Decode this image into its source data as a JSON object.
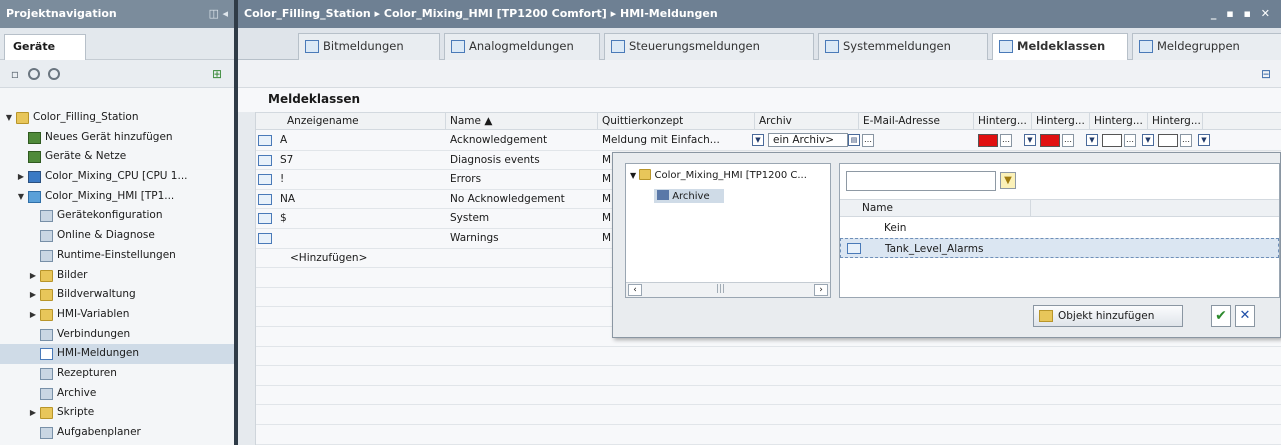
{
  "left_panel": {
    "title": "Projektnavigation",
    "title_controls": "◫ ◂",
    "tab": "Geräte",
    "tree": [
      {
        "label": "Color_Filling_Station",
        "indent": 0,
        "arrow": "▼",
        "icon": "folder"
      },
      {
        "label": "Neues Gerät hinzufügen",
        "indent": 1,
        "arrow": "",
        "icon": "device"
      },
      {
        "label": "Geräte & Netze",
        "indent": 1,
        "arrow": "",
        "icon": "device"
      },
      {
        "label": "Color_Mixing_CPU [CPU 1...",
        "indent": 1,
        "arrow": "▶",
        "icon": "cpu"
      },
      {
        "label": "Color_Mixing_HMI [TP1...",
        "indent": 1,
        "arrow": "▼",
        "icon": "hmi"
      },
      {
        "label": "Gerätekonfiguration",
        "indent": 2,
        "arrow": "",
        "icon": "gen"
      },
      {
        "label": "Online & Diagnose",
        "indent": 2,
        "arrow": "",
        "icon": "gen"
      },
      {
        "label": "Runtime-Einstellungen",
        "indent": 2,
        "arrow": "",
        "icon": "gen"
      },
      {
        "label": "Bilder",
        "indent": 2,
        "arrow": "▶",
        "icon": "folder"
      },
      {
        "label": "Bildverwaltung",
        "indent": 2,
        "arrow": "▶",
        "icon": "folder"
      },
      {
        "label": "HMI-Variablen",
        "indent": 2,
        "arrow": "▶",
        "icon": "folder"
      },
      {
        "label": "Verbindungen",
        "indent": 2,
        "arrow": "",
        "icon": "gen"
      },
      {
        "label": "HMI-Meldungen",
        "indent": 2,
        "arrow": "",
        "icon": "mail",
        "selected": true
      },
      {
        "label": "Rezepturen",
        "indent": 2,
        "arrow": "",
        "icon": "gen"
      },
      {
        "label": "Archive",
        "indent": 2,
        "arrow": "",
        "icon": "gen"
      },
      {
        "label": "Skripte",
        "indent": 2,
        "arrow": "▶",
        "icon": "folder"
      },
      {
        "label": "Aufgabenplaner",
        "indent": 2,
        "arrow": "",
        "icon": "gen"
      }
    ]
  },
  "main": {
    "breadcrumb": "Color_Filling_Station  ▸  Color_Mixing_HMI [TP1200 Comfort]  ▸  HMI-Meldungen",
    "window_controls": "_ ▪ ▪ ✕",
    "tabs": [
      "Bitmeldungen",
      "Analogmeldungen",
      "Steuerungsmeldungen",
      "Systemmeldungen",
      "Meldeklassen",
      "Meldegruppen"
    ],
    "active_tab": "Meldeklassen",
    "section_title": "Meldeklassen",
    "columns": [
      "Anzeigename",
      "Name ▲",
      "Quittierkonzept",
      "Archiv",
      "E-Mail-Adresse",
      "Hinterg...",
      "Hinterg...",
      "Hinterg...",
      "Hinterg..."
    ],
    "rows": [
      {
        "display": "A",
        "name": "Acknowledgement",
        "concept": "Meldung mit Einfach...",
        "archive": "ein Archiv>"
      },
      {
        "display": "S7",
        "name": "Diagnosis events",
        "concept": "M",
        "archive": ""
      },
      {
        "display": "!",
        "name": "Errors",
        "concept": "M",
        "archive": ""
      },
      {
        "display": "NA",
        "name": "No Acknowledgement",
        "concept": "M",
        "archive": ""
      },
      {
        "display": "$",
        "name": "System",
        "concept": "M",
        "archive": ""
      },
      {
        "display": "",
        "name": "Warnings",
        "concept": "M",
        "archive": ""
      }
    ],
    "add_row": "<Hinzufügen>",
    "colors": {
      "red": "#e01010",
      "white": "#ffffff"
    }
  },
  "popup": {
    "tree_root": "Color_Mixing_HMI [TP1200 C...",
    "tree_child": "Archive",
    "list_header": "Name",
    "list_items": [
      "Kein",
      "Tank_Level_Alarms"
    ],
    "add_button": "Objekt hinzufügen",
    "ok": "✔",
    "cancel": "✕"
  }
}
